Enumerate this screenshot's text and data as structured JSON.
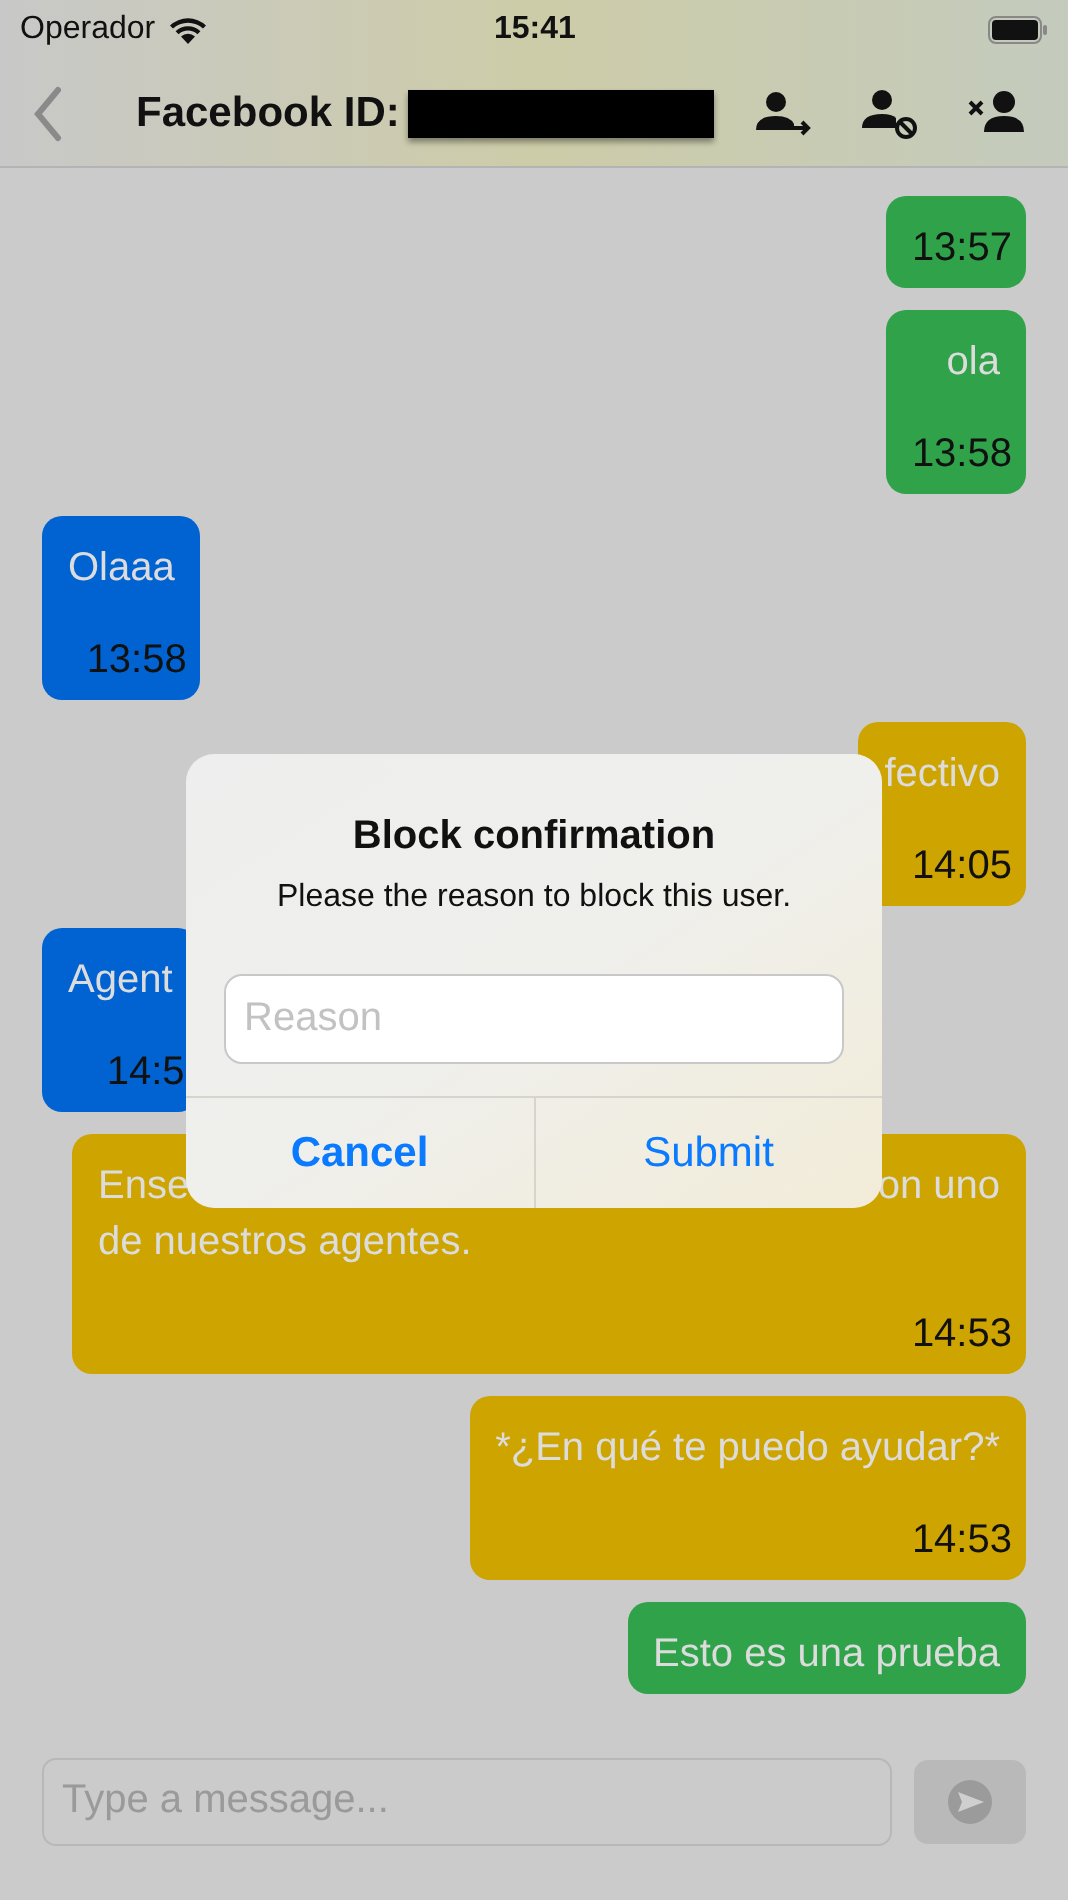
{
  "status_bar": {
    "carrier": "Operador",
    "time": "15:41"
  },
  "nav": {
    "title": "Facebook ID:"
  },
  "messages": [
    {
      "kind": "sent",
      "color": "#2fa24a",
      "time": "13:57"
    },
    {
      "kind": "sent",
      "color": "#2fa24a",
      "lines": [
        [
          "ola"
        ]
      ],
      "time": "13:58"
    },
    {
      "kind": "received",
      "color": "#0063d1",
      "lines": [
        [
          "Olaaa"
        ]
      ],
      "time": "13:58"
    },
    {
      "kind": "sent",
      "color": "#cda400",
      "lines": [
        [
          "fectivo"
        ]
      ],
      "time": "14:05"
    },
    {
      "kind": "received",
      "color": "#0063d1",
      "lines": [
        [
          "Agent"
        ]
      ],
      "time": "14:5"
    },
    {
      "kind": "wide",
      "color": "#cda400",
      "lines": [
        [
          "Ense",
          "on uno"
        ],
        [
          "de nuestros agentes."
        ]
      ],
      "time": "14:53"
    },
    {
      "kind": "sent",
      "color": "#cda400",
      "lines": [
        [
          "*¿En qué te puedo ayudar?*"
        ]
      ],
      "time": "14:53"
    },
    {
      "kind": "sent",
      "color": "#2fa24a",
      "lines": [
        [
          "Esto es una prueba"
        ]
      ]
    }
  ],
  "dialog": {
    "title": "Block confirmation",
    "message": "Please the reason to block this user.",
    "field": {
      "placeholder": "Reason"
    },
    "buttons": [
      {
        "label": "Cancel",
        "kind": "cancel"
      },
      {
        "label": "Submit",
        "kind": "default"
      }
    ]
  },
  "composer": {
    "placeholder": "Type a message..."
  }
}
